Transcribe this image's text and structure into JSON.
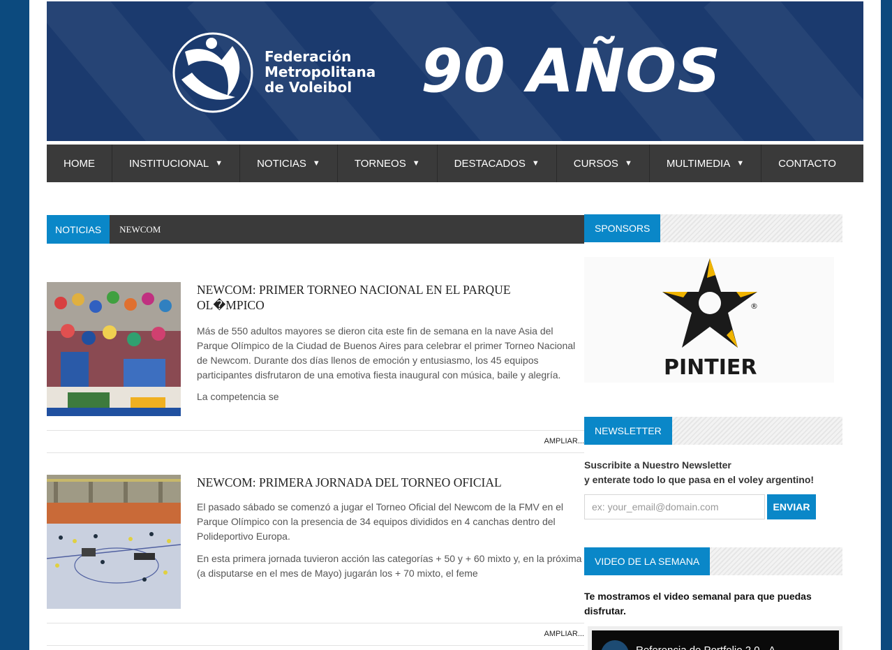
{
  "banner": {
    "org_line1": "Federación",
    "org_line2": "Metropolitana",
    "org_line3": "de Voleibol",
    "anniversary": "90 AÑOS"
  },
  "nav": {
    "items": [
      {
        "label": "HOME",
        "dropdown": false
      },
      {
        "label": "INSTITUCIONAL",
        "dropdown": true
      },
      {
        "label": "NOTICIAS",
        "dropdown": true
      },
      {
        "label": "TORNEOS",
        "dropdown": true
      },
      {
        "label": "DESTACADOS",
        "dropdown": true
      },
      {
        "label": "CURSOS",
        "dropdown": true
      },
      {
        "label": "MULTIMEDIA",
        "dropdown": true
      },
      {
        "label": "CONTACTO",
        "dropdown": false
      }
    ]
  },
  "breadcrumb": {
    "section": "NOTICIAS",
    "current": "NEWCOM"
  },
  "articles": [
    {
      "title": "NEWCOM: PRIMER TORNEO NACIONAL EN EL PARQUE OL�MPICO",
      "paragraph1": "Más de 550 adultos mayores se dieron cita este fin de semana en la nave Asia del Parque Olímpico de la Ciudad de Buenos Aires para celebrar el primer Torneo Nacional de Newcom. Durante dos días llenos de emoción y entusiasmo, los 45 equipos participantes disfrutaron de una emotiva fiesta inaugural con música, baile y alegría.",
      "paragraph2": "La competencia se",
      "more_label": "AMPLIAR..."
    },
    {
      "title": "NEWCOM: PRIMERA JORNADA DEL TORNEO OFICIAL",
      "paragraph1": "El pasado sábado se comenzó a jugar el Torneo Oficial del Newcom de la FMV en el Parque Olímpico con la presencia de 34 equipos divididos en 4 canchas dentro del Polideportivo Europa.",
      "paragraph2": "En esta primera jornada tuvieron acción las categorías + 50 y + 60 mixto y, en la próxima (a disputarse en el mes de Mayo) jugarán los + 70 mixto, el feme",
      "more_label": "AMPLIAR..."
    }
  ],
  "sidebar": {
    "sponsors_title": "SPONSORS",
    "sponsor_name": "PINTIER",
    "newsletter_title": "NEWSLETTER",
    "newsletter_line1": "Suscribite a Nuestro Newsletter",
    "newsletter_line2": "y enterate todo lo que pasa en el voley argentino!",
    "email_placeholder": "ex: your_email@domain.com",
    "send_label": "ENVIAR",
    "video_title": "VIDEO DE LA SEMANA",
    "video_text": "Te mostramos el video semanal para que puedas disfrutar.",
    "video_caption": "Referencia de Portfolio 2.0 - A"
  },
  "colors": {
    "accent": "#0a87c8",
    "nav_bg": "#3a3a3a",
    "banner_bg": "#1b3a6e",
    "outer_bg": "#0c4a7e"
  }
}
